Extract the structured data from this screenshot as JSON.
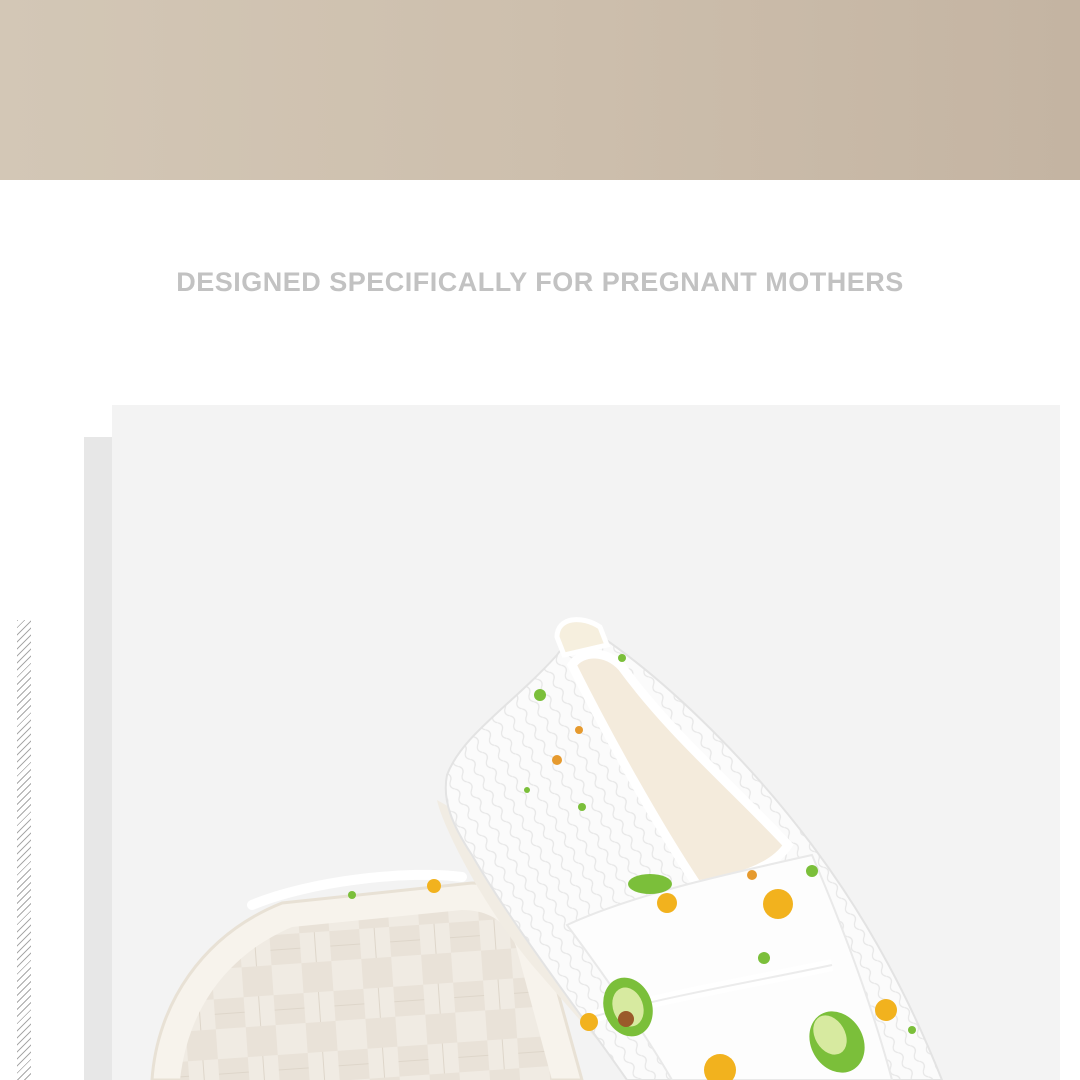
{
  "banner": {
    "color": "#cdbfad"
  },
  "headline": {
    "text": "DESIGNED SPECIFICALLY FOR PREGNANT MOTHERS",
    "color": "#c2c2c2"
  },
  "photo": {
    "subject": "slipper-shoes-image",
    "background_color": "#f3f3f3",
    "print_colors": {
      "avocado": "#7bbf3a",
      "orange": "#f2b21e",
      "lining": "#f4ebdc",
      "sole": "#f1ece3"
    }
  }
}
